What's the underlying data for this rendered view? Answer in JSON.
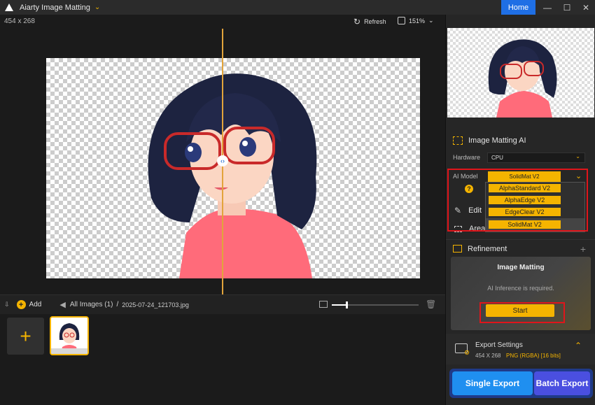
{
  "app": {
    "title": "Aiarty Image Matting",
    "home_label": "Home"
  },
  "viewer": {
    "dimensions": "454 x 268",
    "refresh_label": "Refresh",
    "zoom": "151%"
  },
  "filebar": {
    "add_label": "Add",
    "breadcrumb_root": "All Images (1)",
    "separator": "/",
    "filename": "2025-07-24_121703.jpg"
  },
  "panel": {
    "matting_ai_title": "Image Matting AI",
    "hardware_label": "Hardware",
    "hardware_value": "CPU",
    "ai_model_label": "AI Model",
    "ai_model_value": "SolidMat  V2",
    "model_options": [
      "AlphaStandard  V2",
      "AlphaEdge  V2",
      "EdgeClear  V2",
      "SolidMat  V2"
    ],
    "help_symbol": "?",
    "edit_label": "Edit",
    "area_label": "Area",
    "refinement_label": "Refinement",
    "card_title": "Image Matting",
    "card_message": "AI Inference is required.",
    "start_label": "Start",
    "export_settings_title": "Export Settings",
    "export_dims": "454 X 268",
    "export_format": "PNG (RGBA) [16 bits]",
    "single_export": "Single Export",
    "batch_export": "Batch Export"
  },
  "colors": {
    "accent": "#f5b400",
    "home": "#1f6fe5",
    "highlight": "#e0151b"
  }
}
